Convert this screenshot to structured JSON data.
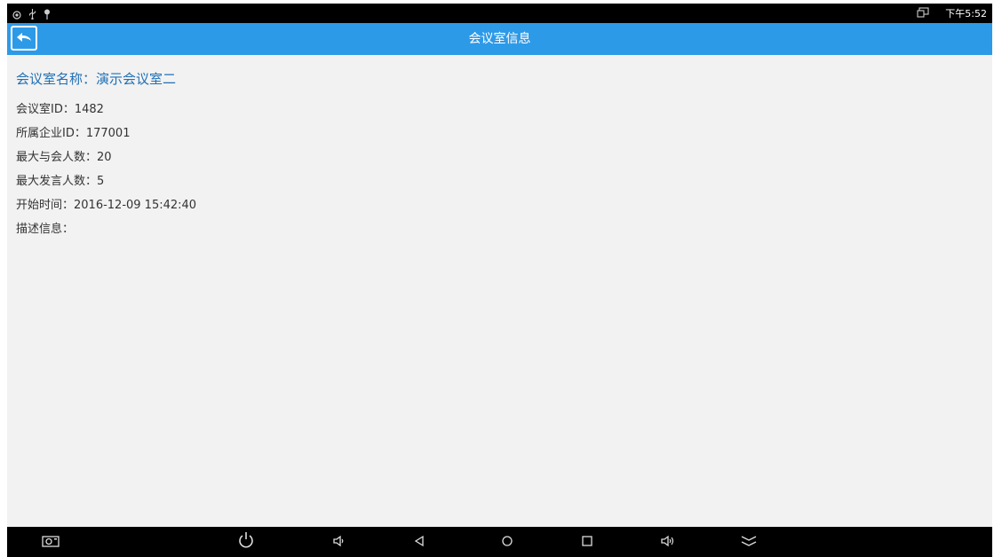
{
  "status_bar": {
    "time": "下午5:52",
    "left_icons": [
      "eye-icon",
      "usb-icon",
      "pin-icon"
    ],
    "right_icons": [
      "screen-cast-icon"
    ]
  },
  "app_bar": {
    "title": "会议室信息",
    "back_icon": "back-arrow-icon"
  },
  "room": {
    "name_line": "会议室名称：演示会议室二",
    "info": [
      "会议室ID：1482",
      "所属企业ID：177001",
      "最大与会人数：20",
      "最大发言人数：5",
      "开始时间：2016-12-09 15:42:40",
      "描述信息："
    ]
  },
  "nav_bar": {
    "buttons": [
      "screenshot-icon",
      "power-icon",
      "volume-down-icon",
      "back-icon",
      "home-icon",
      "recents-icon",
      "volume-up-icon",
      "collapse-icon"
    ]
  },
  "colors": {
    "app_bar": "#2d9ae8",
    "room_name": "#1f6fb5",
    "content_bg": "#f2f2f2",
    "status_bar": "#000000"
  }
}
